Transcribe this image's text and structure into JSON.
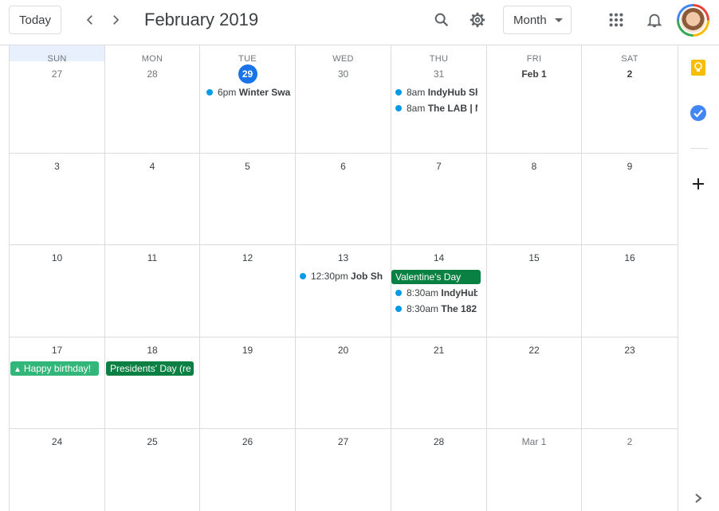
{
  "header": {
    "today_label": "Today",
    "title": "February 2019",
    "view_label": "Month",
    "icons": [
      "chevron-left-icon",
      "chevron-right-icon",
      "search-icon",
      "gear-icon",
      "apps-grid-icon",
      "bell-icon"
    ]
  },
  "weekdays": [
    "SUN",
    "MON",
    "TUE",
    "WED",
    "THU",
    "FRI",
    "SAT"
  ],
  "weeks": [
    [
      "27",
      "28",
      "29",
      "30",
      "31",
      "Feb 1",
      "2"
    ],
    [
      "3",
      "4",
      "5",
      "6",
      "7",
      "8",
      "9"
    ],
    [
      "10",
      "11",
      "12",
      "13",
      "14",
      "15",
      "16"
    ],
    [
      "17",
      "18",
      "19",
      "20",
      "21",
      "22",
      "23"
    ],
    [
      "24",
      "25",
      "26",
      "27",
      "28",
      "Mar 1",
      "2"
    ]
  ],
  "events": {
    "tue29": {
      "time": "6pm",
      "title": "Winter Swa"
    },
    "thu31a": {
      "time": "8am",
      "title": "IndyHub Sh"
    },
    "thu31b": {
      "time": "8am",
      "title": "The LAB | M"
    },
    "wed13": {
      "time": "12:30pm",
      "title": "Job Sh"
    },
    "thu14_allday": "Valentine's Day",
    "thu14a": {
      "time": "8:30am",
      "title": "IndyHub"
    },
    "thu14b": {
      "time": "8:30am",
      "title": "The 182"
    },
    "sun17_allday": "Happy birthday!",
    "mon18_allday": "Presidents' Day (re"
  },
  "colors": {
    "accent": "#1a73e8",
    "dot": "#039be5",
    "holiday": "#0b8043",
    "birthday": "#33b679"
  },
  "sidebar_icons": [
    "keep-icon",
    "tasks-icon",
    "add-icon",
    "expand-icon"
  ]
}
